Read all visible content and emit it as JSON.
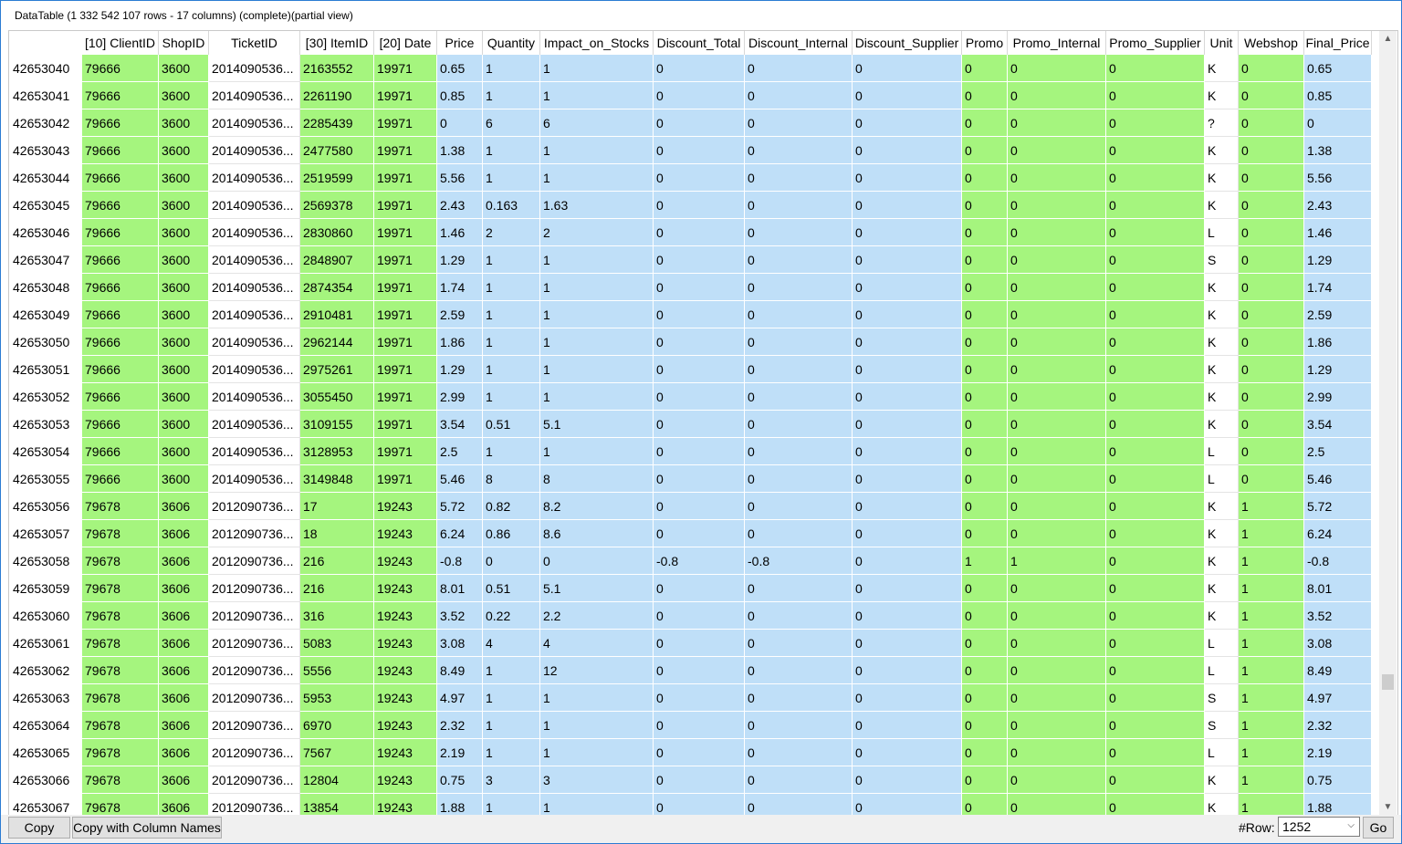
{
  "window": {
    "title": "DataTable (1 332 542 107 rows - 17 columns) (complete)(partial view)"
  },
  "columns": [
    "[10] ClientID",
    "ShopID",
    "TicketID",
    "[30] ItemID",
    "[20] Date",
    "Price",
    "Quantity",
    "Impact_on_Stocks",
    "Discount_Total",
    "Discount_Internal",
    "Discount_Supplier",
    "Promo",
    "Promo_Internal",
    "Promo_Supplier",
    "Unit",
    "Webshop",
    "Final_Price"
  ],
  "rows": [
    [
      "42653040",
      "79666",
      "3600",
      "2014090536...",
      "2163552",
      "19971",
      "0.65",
      "1",
      "1",
      "0",
      "0",
      "0",
      "0",
      "0",
      "0",
      "K",
      "0",
      "0.65"
    ],
    [
      "42653041",
      "79666",
      "3600",
      "2014090536...",
      "2261190",
      "19971",
      "0.85",
      "1",
      "1",
      "0",
      "0",
      "0",
      "0",
      "0",
      "0",
      "K",
      "0",
      "0.85"
    ],
    [
      "42653042",
      "79666",
      "3600",
      "2014090536...",
      "2285439",
      "19971",
      "0",
      "6",
      "6",
      "0",
      "0",
      "0",
      "0",
      "0",
      "0",
      "?",
      "0",
      "0"
    ],
    [
      "42653043",
      "79666",
      "3600",
      "2014090536...",
      "2477580",
      "19971",
      "1.38",
      "1",
      "1",
      "0",
      "0",
      "0",
      "0",
      "0",
      "0",
      "K",
      "0",
      "1.38"
    ],
    [
      "42653044",
      "79666",
      "3600",
      "2014090536...",
      "2519599",
      "19971",
      "5.56",
      "1",
      "1",
      "0",
      "0",
      "0",
      "0",
      "0",
      "0",
      "K",
      "0",
      "5.56"
    ],
    [
      "42653045",
      "79666",
      "3600",
      "2014090536...",
      "2569378",
      "19971",
      "2.43",
      "0.163",
      "1.63",
      "0",
      "0",
      "0",
      "0",
      "0",
      "0",
      "K",
      "0",
      "2.43"
    ],
    [
      "42653046",
      "79666",
      "3600",
      "2014090536...",
      "2830860",
      "19971",
      "1.46",
      "2",
      "2",
      "0",
      "0",
      "0",
      "0",
      "0",
      "0",
      "L",
      "0",
      "1.46"
    ],
    [
      "42653047",
      "79666",
      "3600",
      "2014090536...",
      "2848907",
      "19971",
      "1.29",
      "1",
      "1",
      "0",
      "0",
      "0",
      "0",
      "0",
      "0",
      "S",
      "0",
      "1.29"
    ],
    [
      "42653048",
      "79666",
      "3600",
      "2014090536...",
      "2874354",
      "19971",
      "1.74",
      "1",
      "1",
      "0",
      "0",
      "0",
      "0",
      "0",
      "0",
      "K",
      "0",
      "1.74"
    ],
    [
      "42653049",
      "79666",
      "3600",
      "2014090536...",
      "2910481",
      "19971",
      "2.59",
      "1",
      "1",
      "0",
      "0",
      "0",
      "0",
      "0",
      "0",
      "K",
      "0",
      "2.59"
    ],
    [
      "42653050",
      "79666",
      "3600",
      "2014090536...",
      "2962144",
      "19971",
      "1.86",
      "1",
      "1",
      "0",
      "0",
      "0",
      "0",
      "0",
      "0",
      "K",
      "0",
      "1.86"
    ],
    [
      "42653051",
      "79666",
      "3600",
      "2014090536...",
      "2975261",
      "19971",
      "1.29",
      "1",
      "1",
      "0",
      "0",
      "0",
      "0",
      "0",
      "0",
      "K",
      "0",
      "1.29"
    ],
    [
      "42653052",
      "79666",
      "3600",
      "2014090536...",
      "3055450",
      "19971",
      "2.99",
      "1",
      "1",
      "0",
      "0",
      "0",
      "0",
      "0",
      "0",
      "K",
      "0",
      "2.99"
    ],
    [
      "42653053",
      "79666",
      "3600",
      "2014090536...",
      "3109155",
      "19971",
      "3.54",
      "0.51",
      "5.1",
      "0",
      "0",
      "0",
      "0",
      "0",
      "0",
      "K",
      "0",
      "3.54"
    ],
    [
      "42653054",
      "79666",
      "3600",
      "2014090536...",
      "3128953",
      "19971",
      "2.5",
      "1",
      "1",
      "0",
      "0",
      "0",
      "0",
      "0",
      "0",
      "L",
      "0",
      "2.5"
    ],
    [
      "42653055",
      "79666",
      "3600",
      "2014090536...",
      "3149848",
      "19971",
      "5.46",
      "8",
      "8",
      "0",
      "0",
      "0",
      "0",
      "0",
      "0",
      "L",
      "0",
      "5.46"
    ],
    [
      "42653056",
      "79678",
      "3606",
      "2012090736...",
      "17",
      "19243",
      "5.72",
      "0.82",
      "8.2",
      "0",
      "0",
      "0",
      "0",
      "0",
      "0",
      "K",
      "1",
      "5.72"
    ],
    [
      "42653057",
      "79678",
      "3606",
      "2012090736...",
      "18",
      "19243",
      "6.24",
      "0.86",
      "8.6",
      "0",
      "0",
      "0",
      "0",
      "0",
      "0",
      "K",
      "1",
      "6.24"
    ],
    [
      "42653058",
      "79678",
      "3606",
      "2012090736...",
      "216",
      "19243",
      "-0.8",
      "0",
      "0",
      "-0.8",
      "-0.8",
      "0",
      "1",
      "1",
      "0",
      "K",
      "1",
      "-0.8"
    ],
    [
      "42653059",
      "79678",
      "3606",
      "2012090736...",
      "216",
      "19243",
      "8.01",
      "0.51",
      "5.1",
      "0",
      "0",
      "0",
      "0",
      "0",
      "0",
      "K",
      "1",
      "8.01"
    ],
    [
      "42653060",
      "79678",
      "3606",
      "2012090736...",
      "316",
      "19243",
      "3.52",
      "0.22",
      "2.2",
      "0",
      "0",
      "0",
      "0",
      "0",
      "0",
      "K",
      "1",
      "3.52"
    ],
    [
      "42653061",
      "79678",
      "3606",
      "2012090736...",
      "5083",
      "19243",
      "3.08",
      "4",
      "4",
      "0",
      "0",
      "0",
      "0",
      "0",
      "0",
      "L",
      "1",
      "3.08"
    ],
    [
      "42653062",
      "79678",
      "3606",
      "2012090736...",
      "5556",
      "19243",
      "8.49",
      "1",
      "12",
      "0",
      "0",
      "0",
      "0",
      "0",
      "0",
      "L",
      "1",
      "8.49"
    ],
    [
      "42653063",
      "79678",
      "3606",
      "2012090736...",
      "5953",
      "19243",
      "4.97",
      "1",
      "1",
      "0",
      "0",
      "0",
      "0",
      "0",
      "0",
      "S",
      "1",
      "4.97"
    ],
    [
      "42653064",
      "79678",
      "3606",
      "2012090736...",
      "6970",
      "19243",
      "2.32",
      "1",
      "1",
      "0",
      "0",
      "0",
      "0",
      "0",
      "0",
      "S",
      "1",
      "2.32"
    ],
    [
      "42653065",
      "79678",
      "3606",
      "2012090736...",
      "7567",
      "19243",
      "2.19",
      "1",
      "1",
      "0",
      "0",
      "0",
      "0",
      "0",
      "0",
      "L",
      "1",
      "2.19"
    ],
    [
      "42653066",
      "79678",
      "3606",
      "2012090736...",
      "12804",
      "19243",
      "0.75",
      "3",
      "3",
      "0",
      "0",
      "0",
      "0",
      "0",
      "0",
      "K",
      "1",
      "0.75"
    ],
    [
      "42653067",
      "79678",
      "3606",
      "2012090736...",
      "13854",
      "19243",
      "1.88",
      "1",
      "1",
      "0",
      "0",
      "0",
      "0",
      "0",
      "0",
      "K",
      "1",
      "1.88"
    ]
  ],
  "colors": {
    "green": "#a5f57e",
    "blue": "#bfdff8",
    "white": "#ffffff"
  },
  "footer": {
    "copy_label": "Copy",
    "copy_names_label": "Copy with Column Names",
    "row_label": "#Row:",
    "row_value": "1252",
    "go_label": "Go"
  },
  "icons": {
    "scroll_up": "chevron-up-icon",
    "scroll_down": "chevron-down-icon",
    "dropdown": "chevron-down-icon"
  }
}
